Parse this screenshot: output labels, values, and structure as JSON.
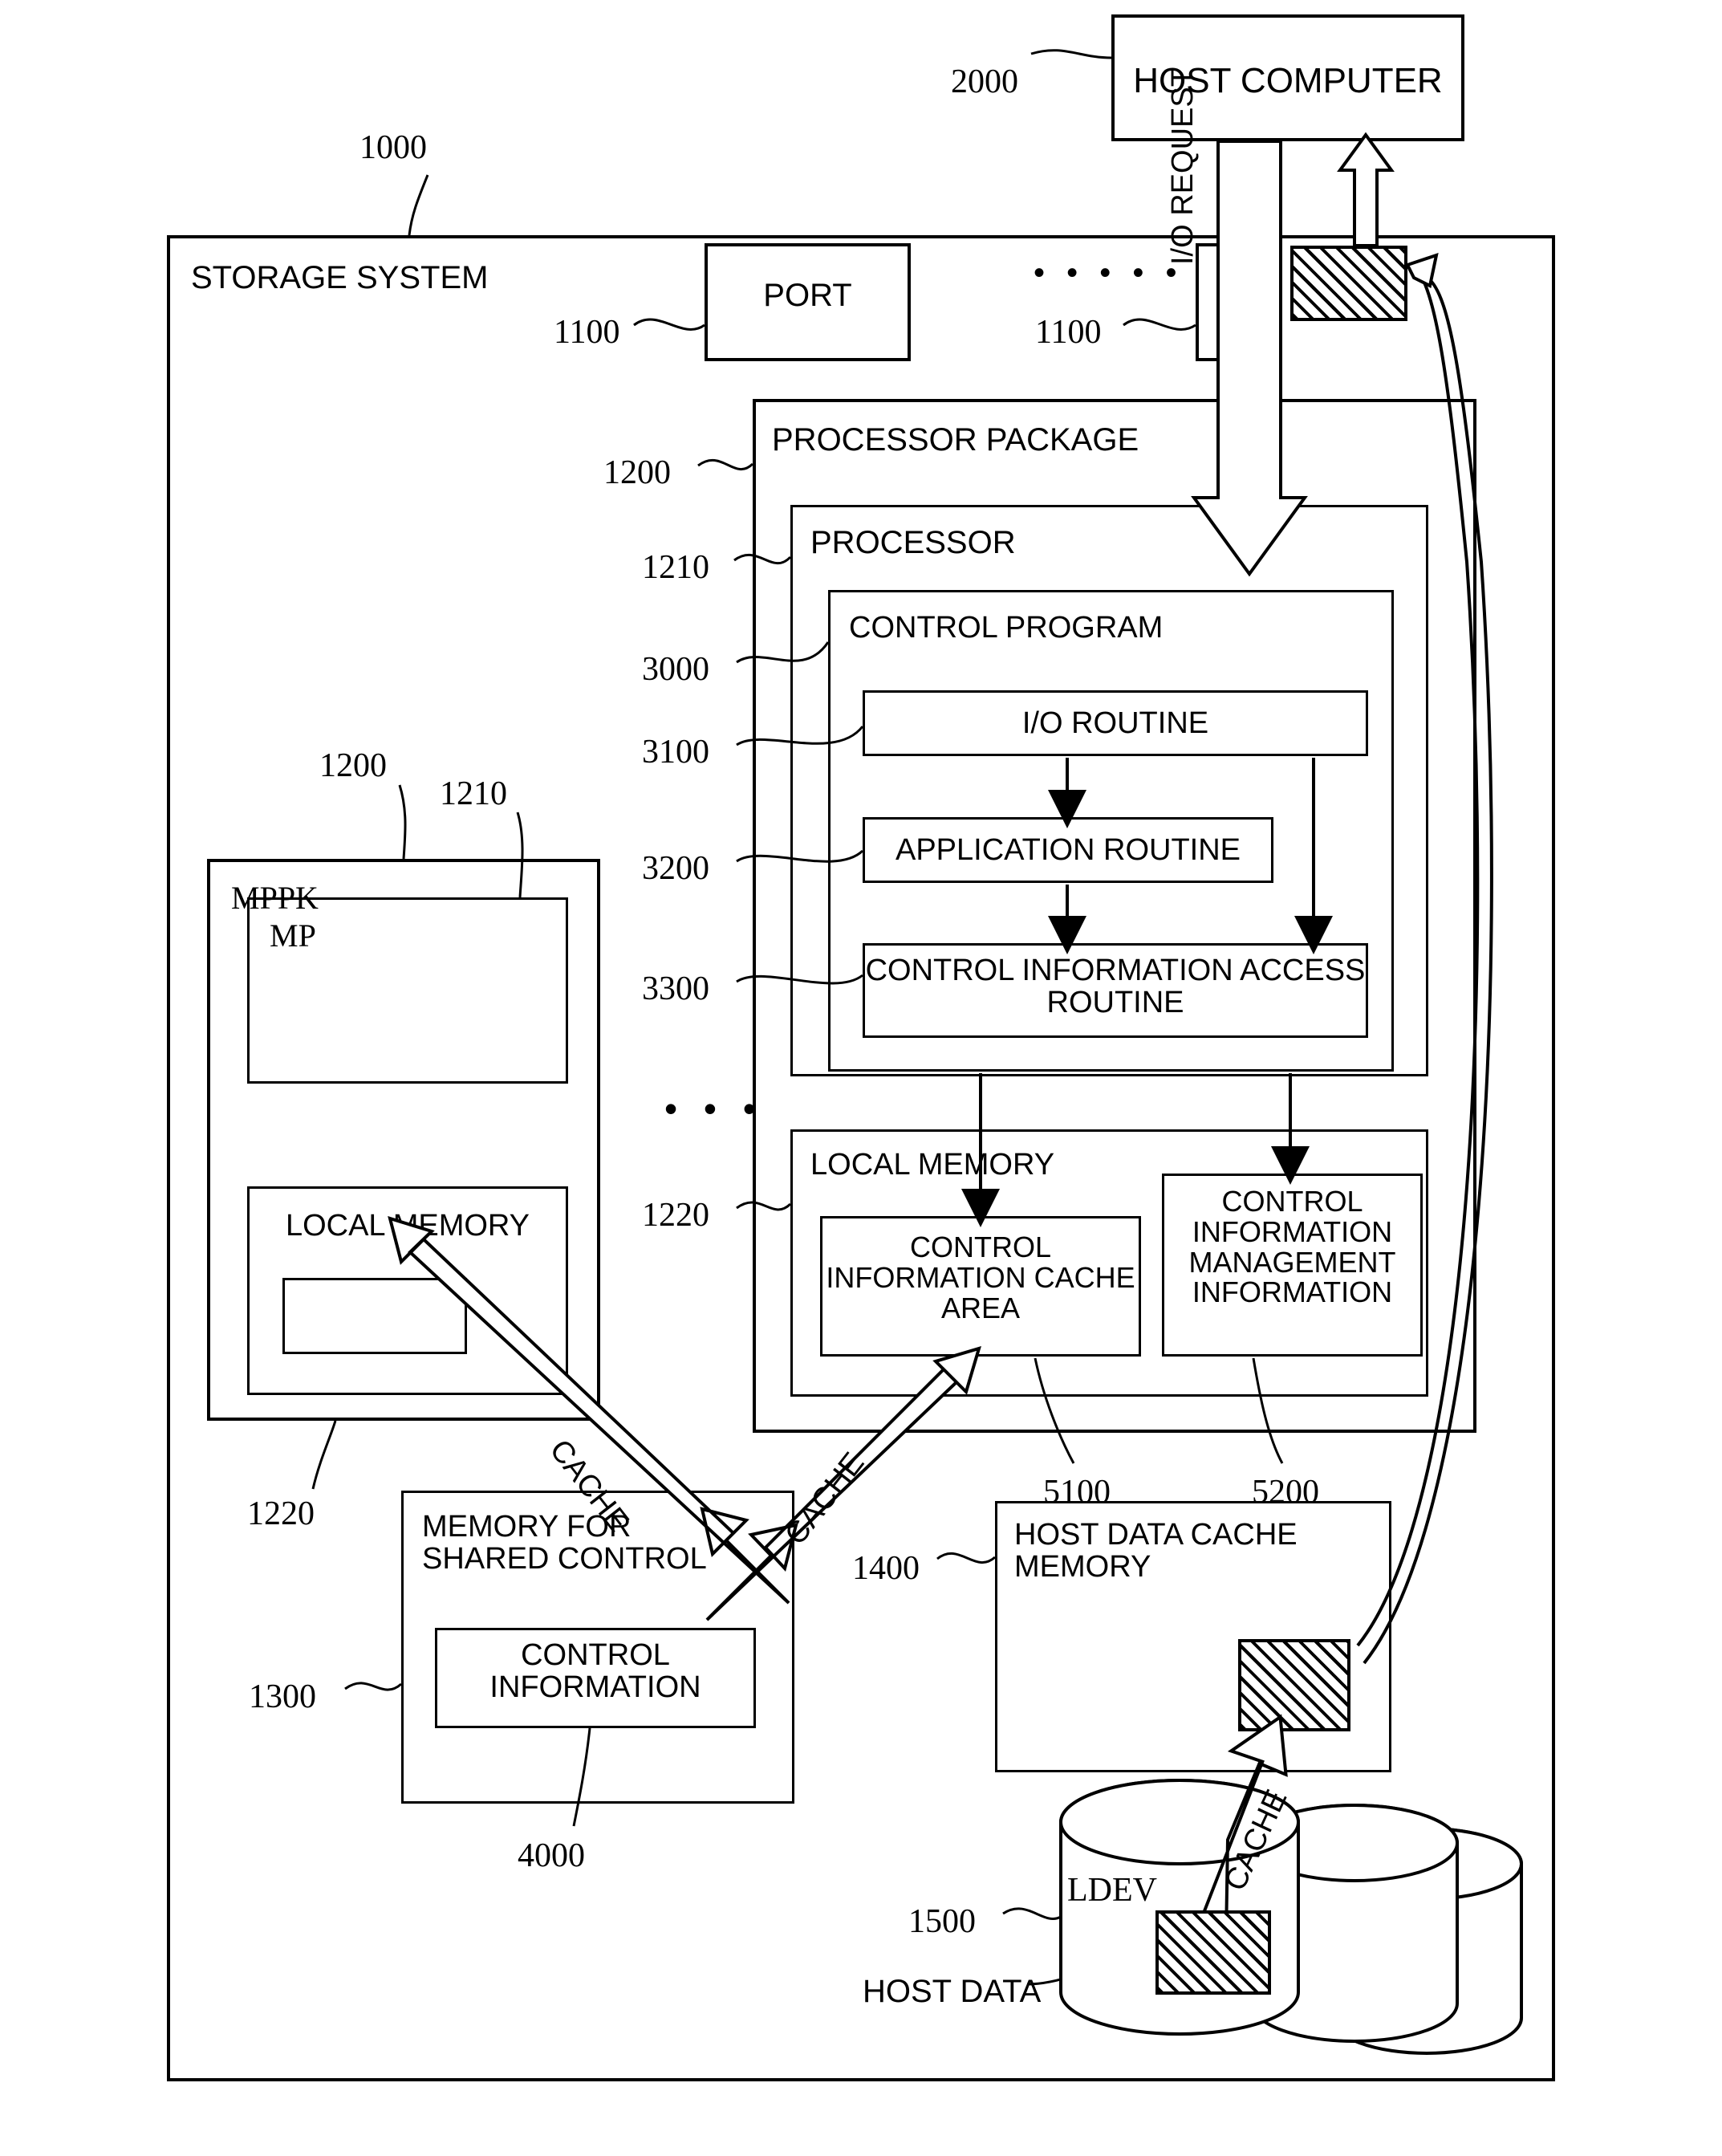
{
  "diagram": {
    "host_computer": {
      "label": "HOST COMPUTER",
      "ref": "2000"
    },
    "storage_system": {
      "label": "STORAGE SYSTEM",
      "ref": "1000"
    },
    "port": {
      "label": "PORT",
      "ref_left": "1100",
      "ref_right": "1100",
      "ellipsis": "• • • • •"
    },
    "io_request": {
      "label": "I/O REQUEST"
    },
    "processor_package": {
      "label": "PROCESSOR PACKAGE",
      "ref": "1200"
    },
    "processor": {
      "label": "PROCESSOR",
      "ref": "1210"
    },
    "control_program": {
      "label": "CONTROL PROGRAM",
      "ref": "3000"
    },
    "io_routine": {
      "label": "I/O ROUTINE",
      "ref": "3100"
    },
    "application_routine": {
      "label": "APPLICATION ROUTINE",
      "ref": "3200"
    },
    "control_info_access_routine": {
      "label": "CONTROL INFORMATION ACCESS\nROUTINE",
      "ref": "3300"
    },
    "local_memory_pp": {
      "label": "LOCAL MEMORY",
      "ref": "1220"
    },
    "control_info_cache_area": {
      "label": "CONTROL\nINFORMATION CACHE\nAREA",
      "ref": "5100"
    },
    "control_info_mgmt_info": {
      "label": "CONTROL\nINFORMATION\nMANAGEMENT\nINFORMATION",
      "ref": "5200"
    },
    "mppk": {
      "label": "MPPK",
      "ref": "1200"
    },
    "mp": {
      "label": "MP",
      "ref": "1210"
    },
    "local_memory_mppk": {
      "label": "LOCAL MEMORY",
      "ref": "1220"
    },
    "shared_control_memory": {
      "label": "MEMORY FOR\nSHARED CONTROL",
      "ref": "1300"
    },
    "control_information": {
      "label": "CONTROL\nINFORMATION",
      "ref": "4000"
    },
    "host_data_cache_memory": {
      "label": "HOST DATA CACHE\nMEMORY",
      "ref": "1400"
    },
    "ldev": {
      "label": "LDEV",
      "ref": "1500"
    },
    "host_data": {
      "label": "HOST DATA"
    },
    "cache_arrow_left": {
      "label": "CACHE"
    },
    "cache_arrow_right": {
      "label": "CACHE"
    },
    "cache_arrow_disk": {
      "label": "CACHE"
    },
    "ellipsis_packages": "• • •",
    "ellipsis_ldev": "• • •"
  }
}
